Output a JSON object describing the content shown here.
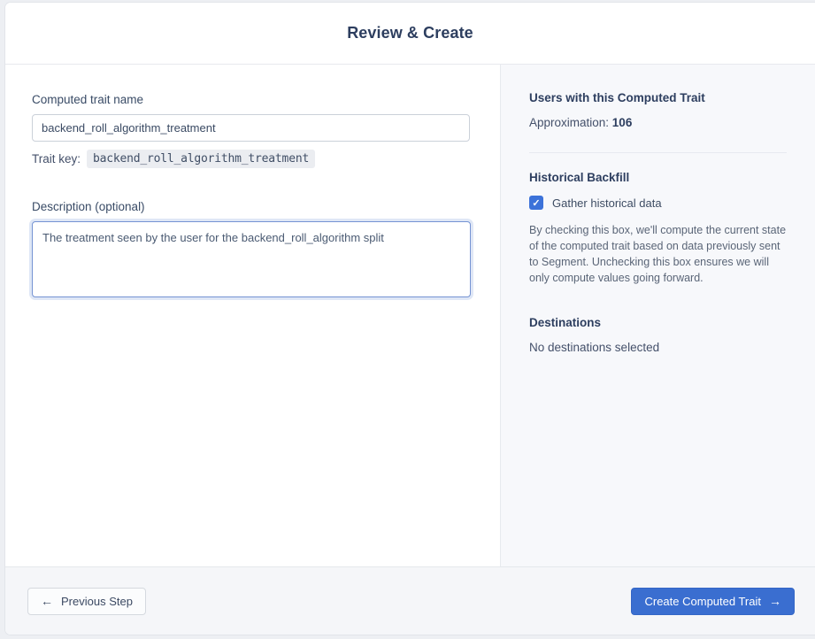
{
  "header": {
    "title": "Review & Create"
  },
  "form": {
    "trait_name_label": "Computed trait name",
    "trait_name_value": "backend_roll_algorithm_treatment",
    "trait_key_label": "Trait key:",
    "trait_key_value": "backend_roll_algorithm_treatment",
    "description_label": "Description (optional)",
    "description_value": "The treatment seen by the user for the backend_roll_algorithm split"
  },
  "summary": {
    "users_heading": "Users with this Computed Trait",
    "approximation_label": "Approximation: ",
    "approximation_value": "106",
    "backfill_heading": "Historical Backfill",
    "backfill_checkbox_checked": true,
    "backfill_checkbox_label": "Gather historical data",
    "backfill_description": "By checking this box, we'll compute the current state of the computed trait based on data previously sent to Segment. Unchecking this box ensures we will only compute values going forward.",
    "destinations_heading": "Destinations",
    "destinations_value": "No destinations selected"
  },
  "footer": {
    "previous_icon": "←",
    "previous_label": "Previous Step",
    "create_label": "Create Computed Trait",
    "create_icon": "→"
  },
  "icons": {
    "check": "✓"
  },
  "colors": {
    "accent_blue": "#3a6ed0",
    "checkbox_blue": "#3c72d9",
    "heading_navy": "#2d3e5f",
    "panel_gray": "#f7f8fb",
    "footer_gray": "#f5f6f9"
  }
}
